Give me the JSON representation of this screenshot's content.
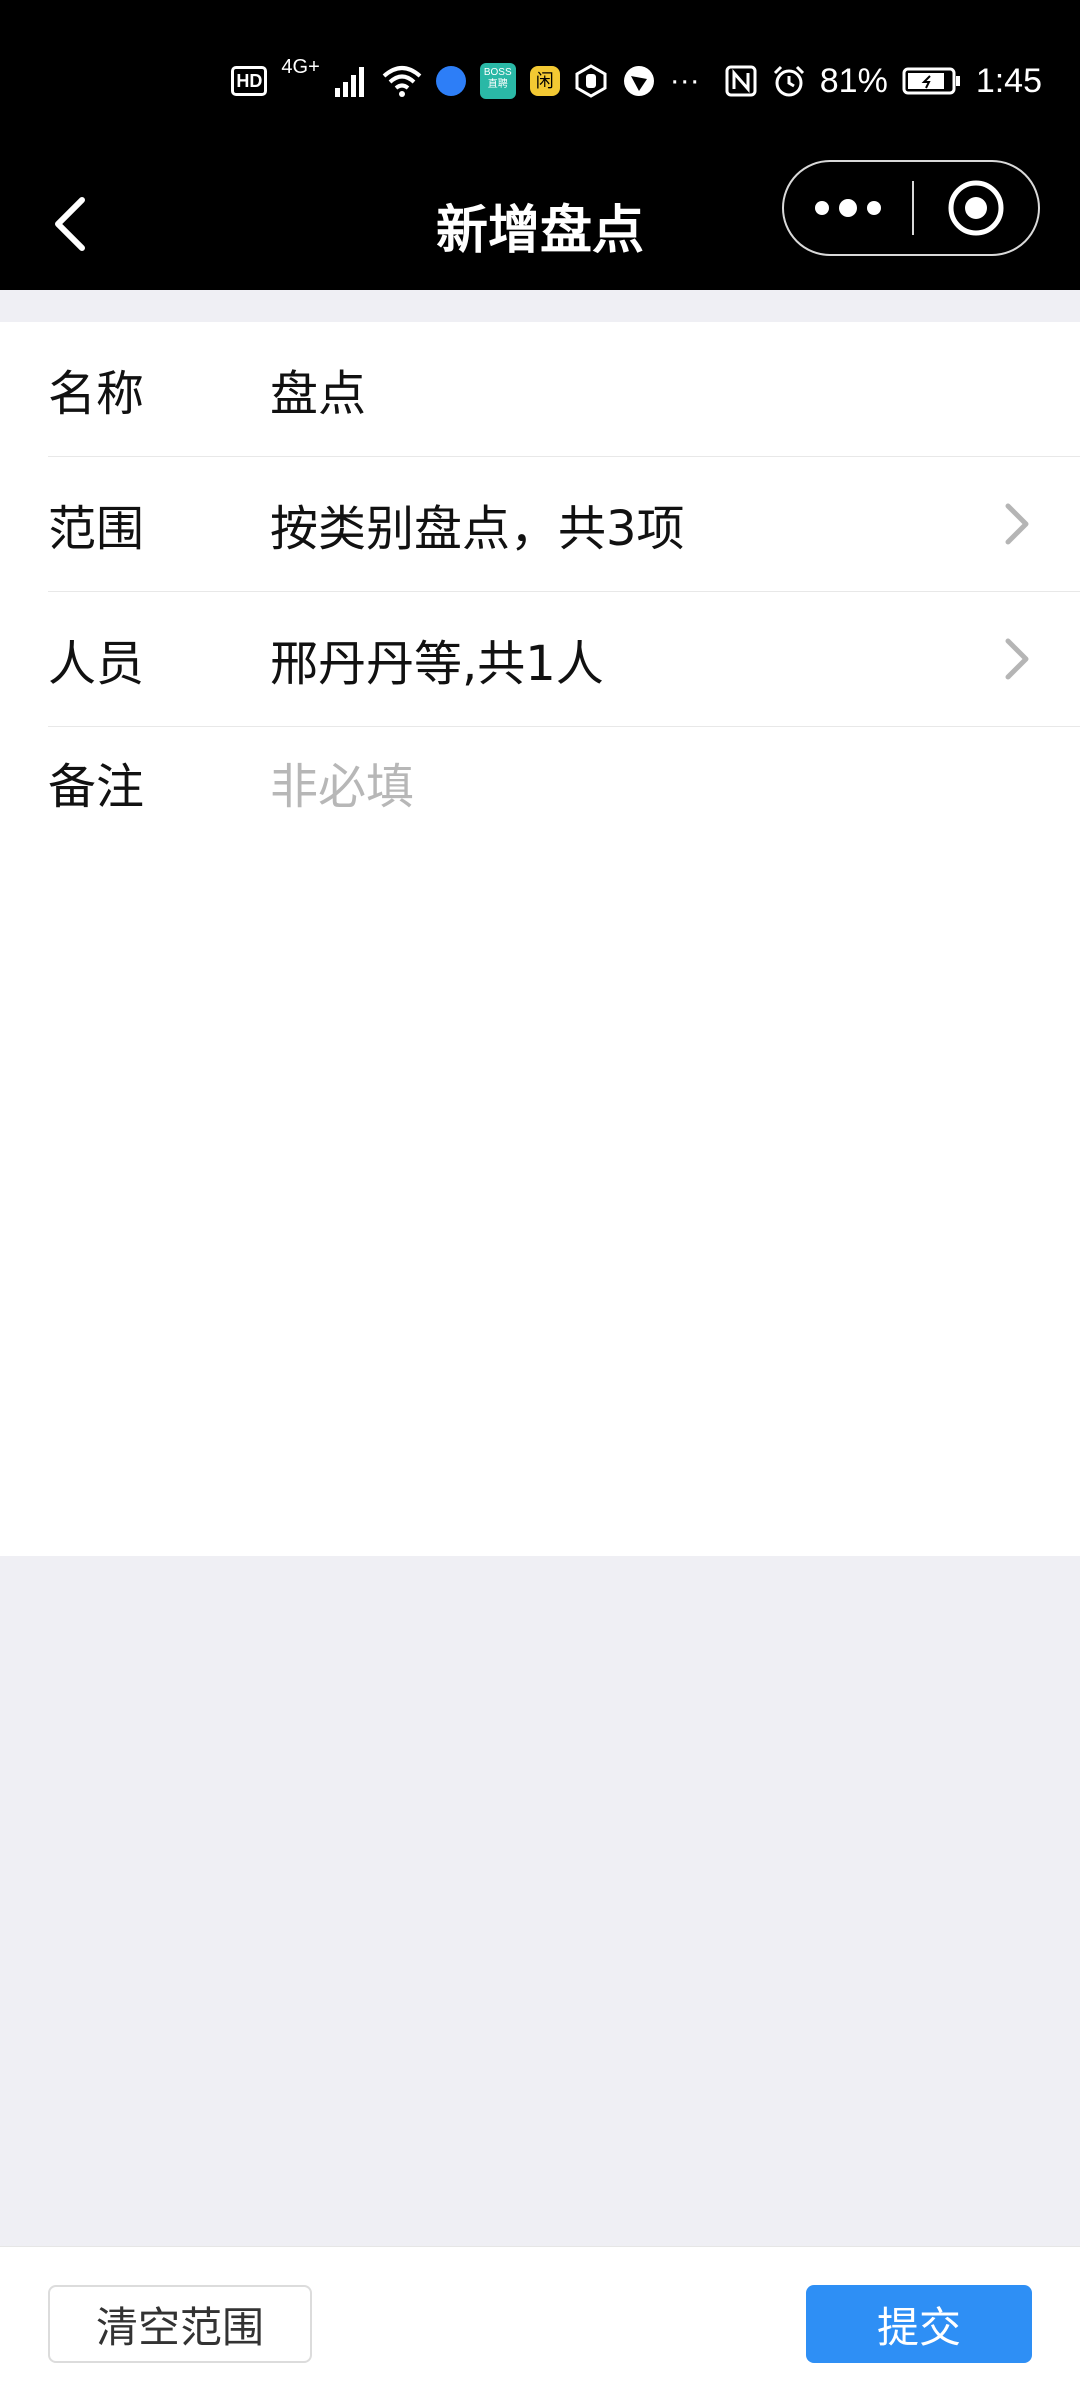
{
  "status_bar": {
    "hd": "HD",
    "network": "4G+",
    "boss_label": "BOSS\n直聘",
    "xian_label": "闲",
    "more": "···",
    "battery_percent": "81%",
    "time": "1:45"
  },
  "nav": {
    "title": "新增盘点"
  },
  "form": {
    "rows": [
      {
        "label": "名称",
        "value": "盘点"
      },
      {
        "label": "范围",
        "value": "按类别盘点，共3项"
      },
      {
        "label": "人员",
        "value": "邢丹丹等,共1人"
      },
      {
        "label": "备注",
        "placeholder": "非必填"
      }
    ]
  },
  "bottom": {
    "clear_label": "清空范围",
    "submit_label": "提交"
  },
  "colors": {
    "submit_bg": "#2e8ff5",
    "page_bg": "#efeff4"
  }
}
